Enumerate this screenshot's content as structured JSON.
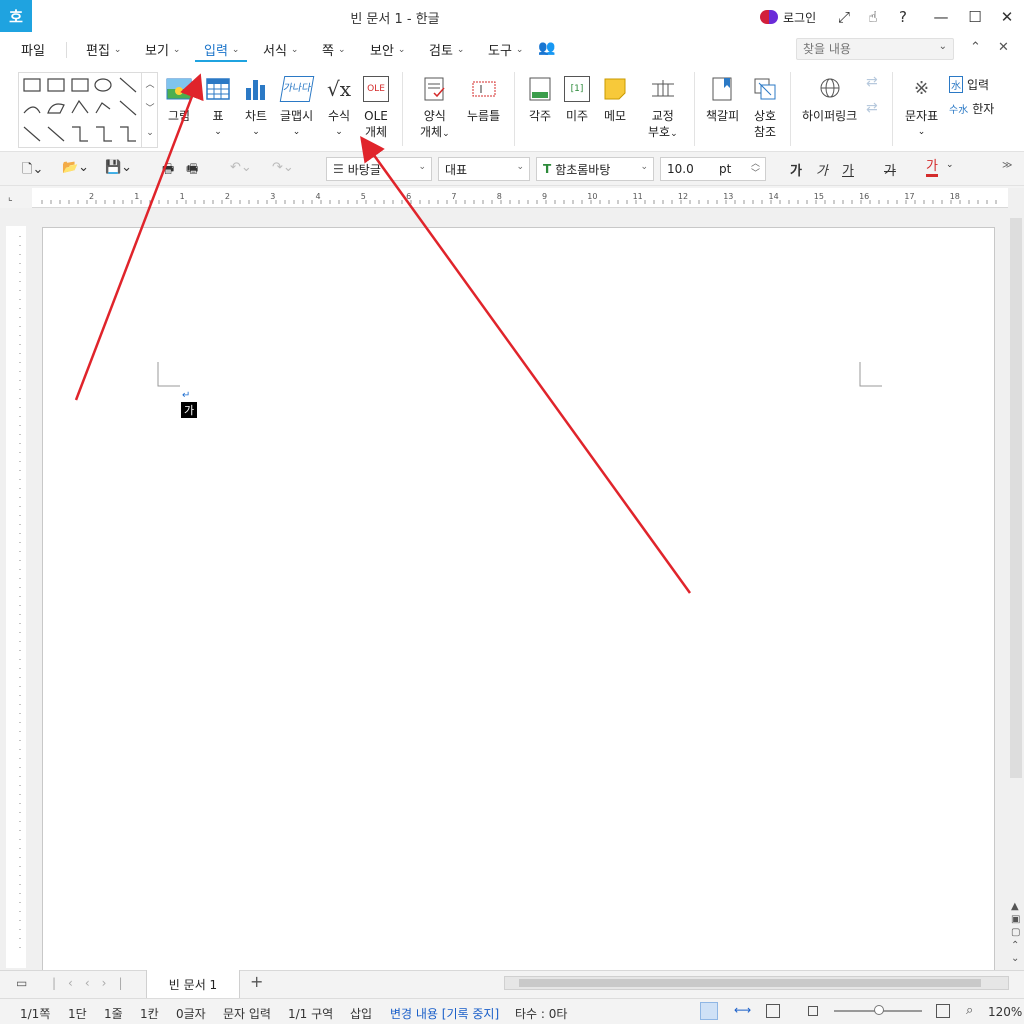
{
  "window": {
    "title": "빈 문서 1 - 한글",
    "logo": "호",
    "login": "로그인"
  },
  "menu": {
    "items": [
      {
        "label": "파일"
      },
      {
        "label": "편집"
      },
      {
        "label": "보기"
      },
      {
        "label": "입력"
      },
      {
        "label": "서식"
      },
      {
        "label": "쪽"
      },
      {
        "label": "보안"
      },
      {
        "label": "검토"
      },
      {
        "label": "도구"
      }
    ],
    "active": "입력",
    "search_placeholder": "찾을 내용"
  },
  "ribbon": {
    "buttons": [
      {
        "label": "그림"
      },
      {
        "label": "표"
      },
      {
        "label": "차트"
      },
      {
        "label": "글맵시"
      },
      {
        "label": "수식"
      },
      {
        "label": "OLE"
      },
      {
        "label": "개체"
      },
      {
        "label": "양식"
      },
      {
        "label": "개체"
      },
      {
        "label": "누름틀"
      },
      {
        "label": "각주"
      },
      {
        "label": "미주"
      },
      {
        "label": "메모"
      },
      {
        "label": "교정"
      },
      {
        "label": "부호"
      },
      {
        "label": "책갈피"
      },
      {
        "label": "상호"
      },
      {
        "label": "참조"
      },
      {
        "label": "하이퍼링크"
      },
      {
        "label": "문자표"
      },
      {
        "label": "입력"
      },
      {
        "label": "한자"
      }
    ],
    "icon_text": {
      "chart_word": "가나다",
      "ole": "OLE",
      "note": "[1]"
    }
  },
  "toolbar": {
    "style": "바탕글",
    "style2": "대표",
    "font": "함초롬바탕",
    "size": "10.0",
    "unit": "pt",
    "fmt": [
      "가",
      "가",
      "가",
      "가",
      "가"
    ]
  },
  "ruler": {
    "h_ticks": [
      "2",
      "1",
      "1",
      "2",
      "3",
      "4",
      "5",
      "6",
      "7",
      "8",
      "9",
      "10",
      "11",
      "12",
      "13",
      "14",
      "15",
      "16",
      "17",
      "18"
    ]
  },
  "document": {
    "cursor_char": "가",
    "tab_name": "빈 문서 1"
  },
  "status": {
    "page": "1/1쪽",
    "col": "1단",
    "line": "1줄",
    "cell": "1칸",
    "chars": "0글자",
    "mode": "문자 입력",
    "section": "1/1 구역",
    "insert": "삽입",
    "track": "변경 내용 [기록 중지]",
    "typing": "타수 : 0타",
    "zoom": "120%"
  },
  "colors": {
    "accent": "#1fa3e0",
    "arrow": "#e0242b",
    "track": "#1a5fc9"
  }
}
